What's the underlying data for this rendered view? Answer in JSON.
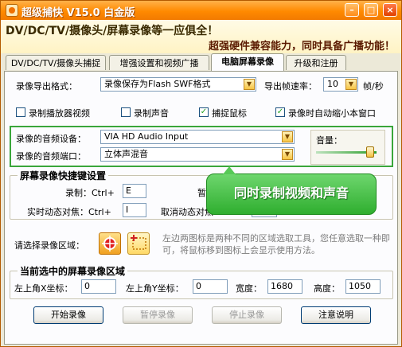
{
  "window": {
    "title": "超级捕快 V15.0 白金版",
    "min": "–",
    "max": "□",
    "close": "×"
  },
  "banner": {
    "line1": "DV/DC/TV/摄像头/屏幕录像等一应俱全！",
    "line2": "超强硬件兼容能力，同时具备广播功能！"
  },
  "tabs": [
    "DV/DC/TV/摄像头捕捉",
    "增强设置和视频广播",
    "电脑屏幕录像",
    "升级和注册"
  ],
  "export": {
    "label": "录像导出格式：",
    "value": "录像保存为Flash SWF格式",
    "fps_label": "导出帧速率：",
    "fps_value": "10",
    "fps_unit": "帧/秒"
  },
  "checks": [
    {
      "label": "录制播放器视频",
      "checked": false
    },
    {
      "label": "录制声音",
      "checked": false
    },
    {
      "label": "捕捉鼠标",
      "checked": true
    },
    {
      "label": "录像时自动缩小本窗口",
      "checked": true
    }
  ],
  "audio": {
    "device_label": "录像的音频设备：",
    "device_value": "VIA HD Audio Input",
    "port_label": "录像的音频端口：",
    "port_value": "立体声混音",
    "volume_label": "音量：",
    "volume_level": 0.9
  },
  "hotkeys": {
    "title": "屏幕录像快捷键设置",
    "record_label": "录制：Ctrl+",
    "record_value": "E",
    "pause_label": "暂停",
    "pause_value": "",
    "focus_label": "实时动态对焦：Ctrl+",
    "focus_value": "I",
    "cancel_label": "取消动态对焦",
    "cancel_value": ""
  },
  "region": {
    "label": "请选择录像区域：",
    "hint": "左边两图标是两种不同的区域选取工具，您任意选取一种即可，将鼠标移到图标上会显示使用方法。"
  },
  "current": {
    "title": "当前选中的屏幕录像区域",
    "x_label": "左上角X坐标：",
    "x_value": "0",
    "y_label": "左上角Y坐标：",
    "y_value": "0",
    "w_label": "宽度：",
    "w_value": "1680",
    "h_label": "高度：",
    "h_value": "1050"
  },
  "buttons": {
    "start": "开始录像",
    "pause": "暂停录像",
    "stop": "停止录像",
    "help": "注意说明"
  },
  "tooltip": "同时录制视频和声音",
  "colors": {
    "accent": "#ff8a00",
    "green": "#2fae2f"
  }
}
